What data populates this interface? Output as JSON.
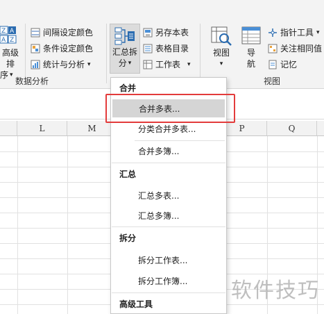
{
  "ribbon": {
    "left_big_button": {
      "line1": "高级排",
      "line2": "序",
      "line2_caret": "▾"
    },
    "data_analysis_items": [
      {
        "label": "间隔设定颜色",
        "icon": "interval-color-icon"
      },
      {
        "label": "条件设定颜色",
        "icon": "condition-color-icon"
      },
      {
        "label": "统计与分析",
        "icon": "statistics-icon",
        "caret": "▾"
      }
    ],
    "data_analysis_label": "数据分析",
    "merge_split_button": {
      "line1": "汇总拆",
      "line2": "分",
      "caret": "▾"
    },
    "table_items": [
      {
        "label": "另存本表",
        "icon": "save-sheet-icon"
      },
      {
        "label": "表格目录",
        "icon": "sheet-directory-icon"
      },
      {
        "label": "工作表",
        "icon": "worksheet-icon",
        "caret": "▾"
      }
    ],
    "view_button": {
      "label": "视图",
      "caret": "▾"
    },
    "nav_button": {
      "line1": "导",
      "line2": "航"
    },
    "view_items": [
      {
        "label": "指针工具",
        "icon": "pointer-tool-icon",
        "caret": "▾"
      },
      {
        "label": "关注相同值",
        "icon": "watch-same-icon"
      },
      {
        "label": "记忆",
        "icon": "memory-icon"
      }
    ],
    "view_group_label": "视图"
  },
  "grid": {
    "columns": [
      "L",
      "M",
      "P",
      "Q"
    ]
  },
  "dropdown": {
    "sections": [
      {
        "title": "合并",
        "items": [
          "合并多表...",
          "分类合并多表...",
          "合并多簿..."
        ]
      },
      {
        "title": "汇总",
        "items": [
          "汇总多表...",
          "汇总多簿..."
        ]
      },
      {
        "title": "拆分",
        "items": [
          "拆分工作表...",
          "拆分工作簿..."
        ]
      },
      {
        "title": "高级工具",
        "items": []
      }
    ],
    "highlighted_item": "合并多表...",
    "highlight_color": "#e33b3b"
  },
  "watermark": "软件技巧"
}
